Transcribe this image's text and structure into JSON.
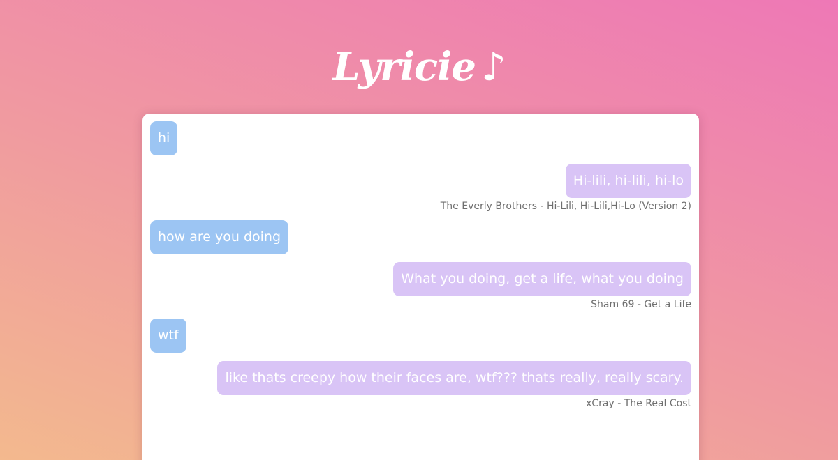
{
  "app": {
    "title": "Lyricie",
    "title_icon": "♪"
  },
  "messages": [
    {
      "sender": "user",
      "text": "hi"
    },
    {
      "sender": "bot",
      "text": "Hi-lili, hi-lili, hi-lo",
      "source": "The Everly Brothers - Hi-Lili, Hi-Lili,Hi-Lo (Version 2)"
    },
    {
      "sender": "user",
      "text": "how are you doing"
    },
    {
      "sender": "bot",
      "text": "What you doing, get a life, what you doing",
      "source": "Sham 69 - Get a Life"
    },
    {
      "sender": "user",
      "text": "wtf"
    },
    {
      "sender": "bot",
      "text": "like thats creepy how their faces are, wtf??? thats really, really scary.",
      "source": "xCray - The Real Cost"
    }
  ],
  "colors": {
    "user_bubble": "#9cc5f3",
    "bot_bubble": "#d9c4f6",
    "background_start": "#f3b98e",
    "background_end": "#ee78b6"
  }
}
